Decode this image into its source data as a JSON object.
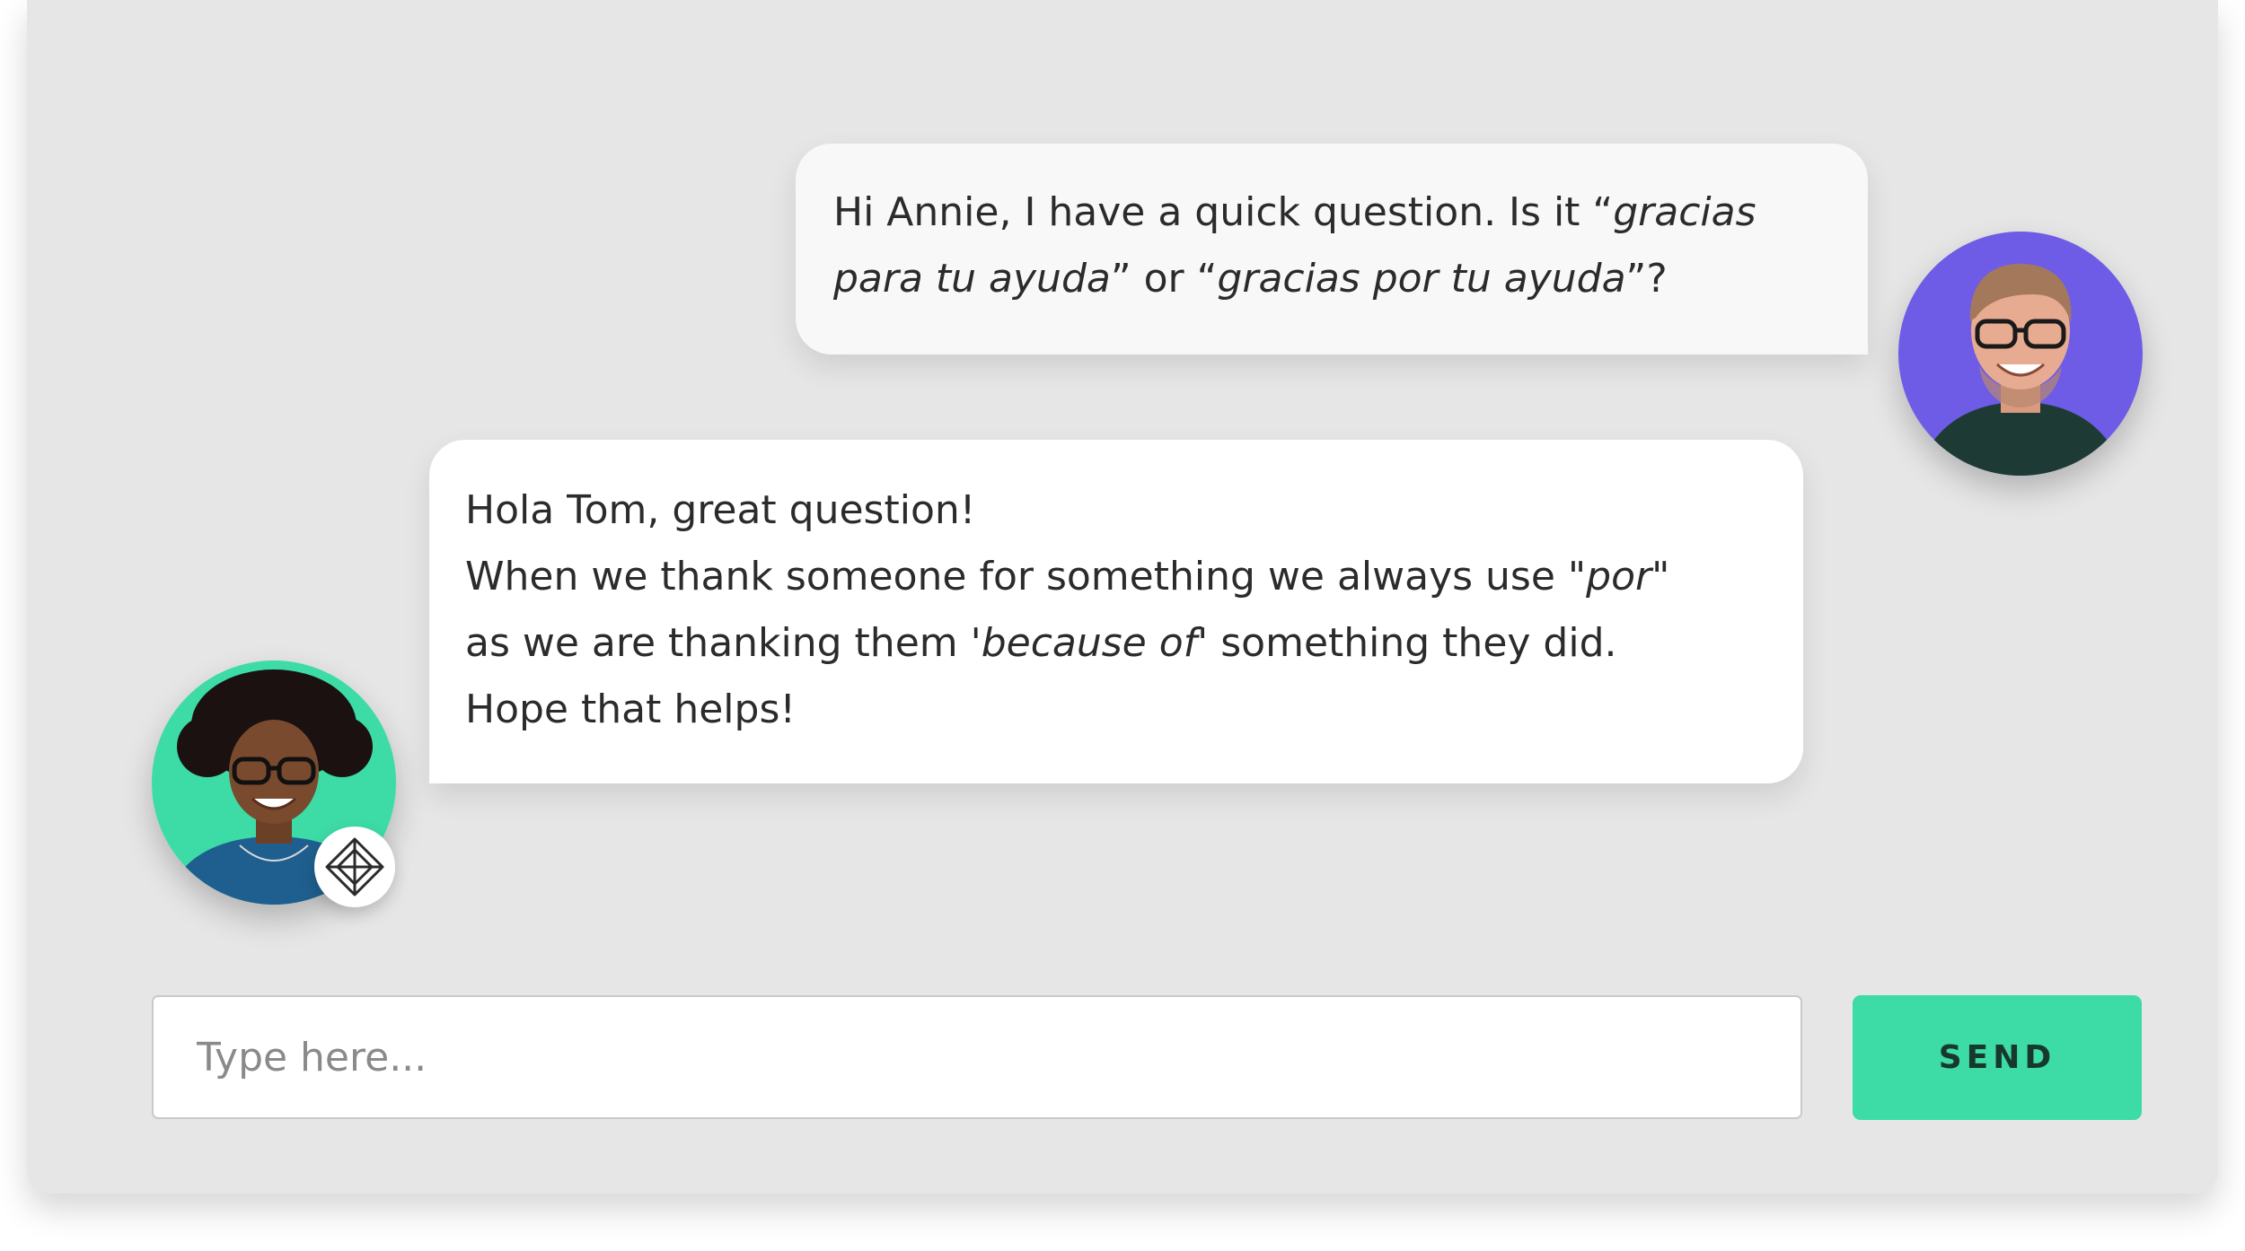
{
  "messages": [
    {
      "sender": "Tom",
      "lines": [
        [
          {
            "text": "Hi Annie, I have a quick question. Is it “",
            "italic": false
          },
          {
            "text": "gracias",
            "italic": true
          }
        ],
        [
          {
            "text": "para tu ayuda",
            "italic": true
          },
          {
            "text": "” or “",
            "italic": false
          },
          {
            "text": "gracias por tu ayuda",
            "italic": true
          },
          {
            "text": "”?",
            "italic": false
          }
        ]
      ]
    },
    {
      "sender": "Annie",
      "lines": [
        [
          {
            "text": "Hola Tom, great question!",
            "italic": false
          }
        ],
        [
          {
            "text": "When we thank someone for something we always use \"",
            "italic": false
          },
          {
            "text": "por",
            "italic": true
          },
          {
            "text": "\"",
            "italic": false
          }
        ],
        [
          {
            "text": "as we are thanking them ",
            "italic": false
          },
          {
            "text": "'because of'",
            "italic": true
          },
          {
            "text": " something they did.",
            "italic": false
          }
        ],
        [
          {
            "text": "Hope that helps!",
            "italic": false
          }
        ]
      ]
    }
  ],
  "avatars": {
    "tom": {
      "background_color": "#6f5ce6"
    },
    "annie": {
      "background_color": "#3ddba6",
      "badge_icon": "tutor-badge-icon"
    }
  },
  "composer": {
    "placeholder": "Type here...",
    "value": "",
    "send_label": "SEND"
  },
  "colors": {
    "panel_background": "#e6e6e6",
    "accent": "#3ddba6",
    "tom_avatar": "#6f5ce6"
  }
}
